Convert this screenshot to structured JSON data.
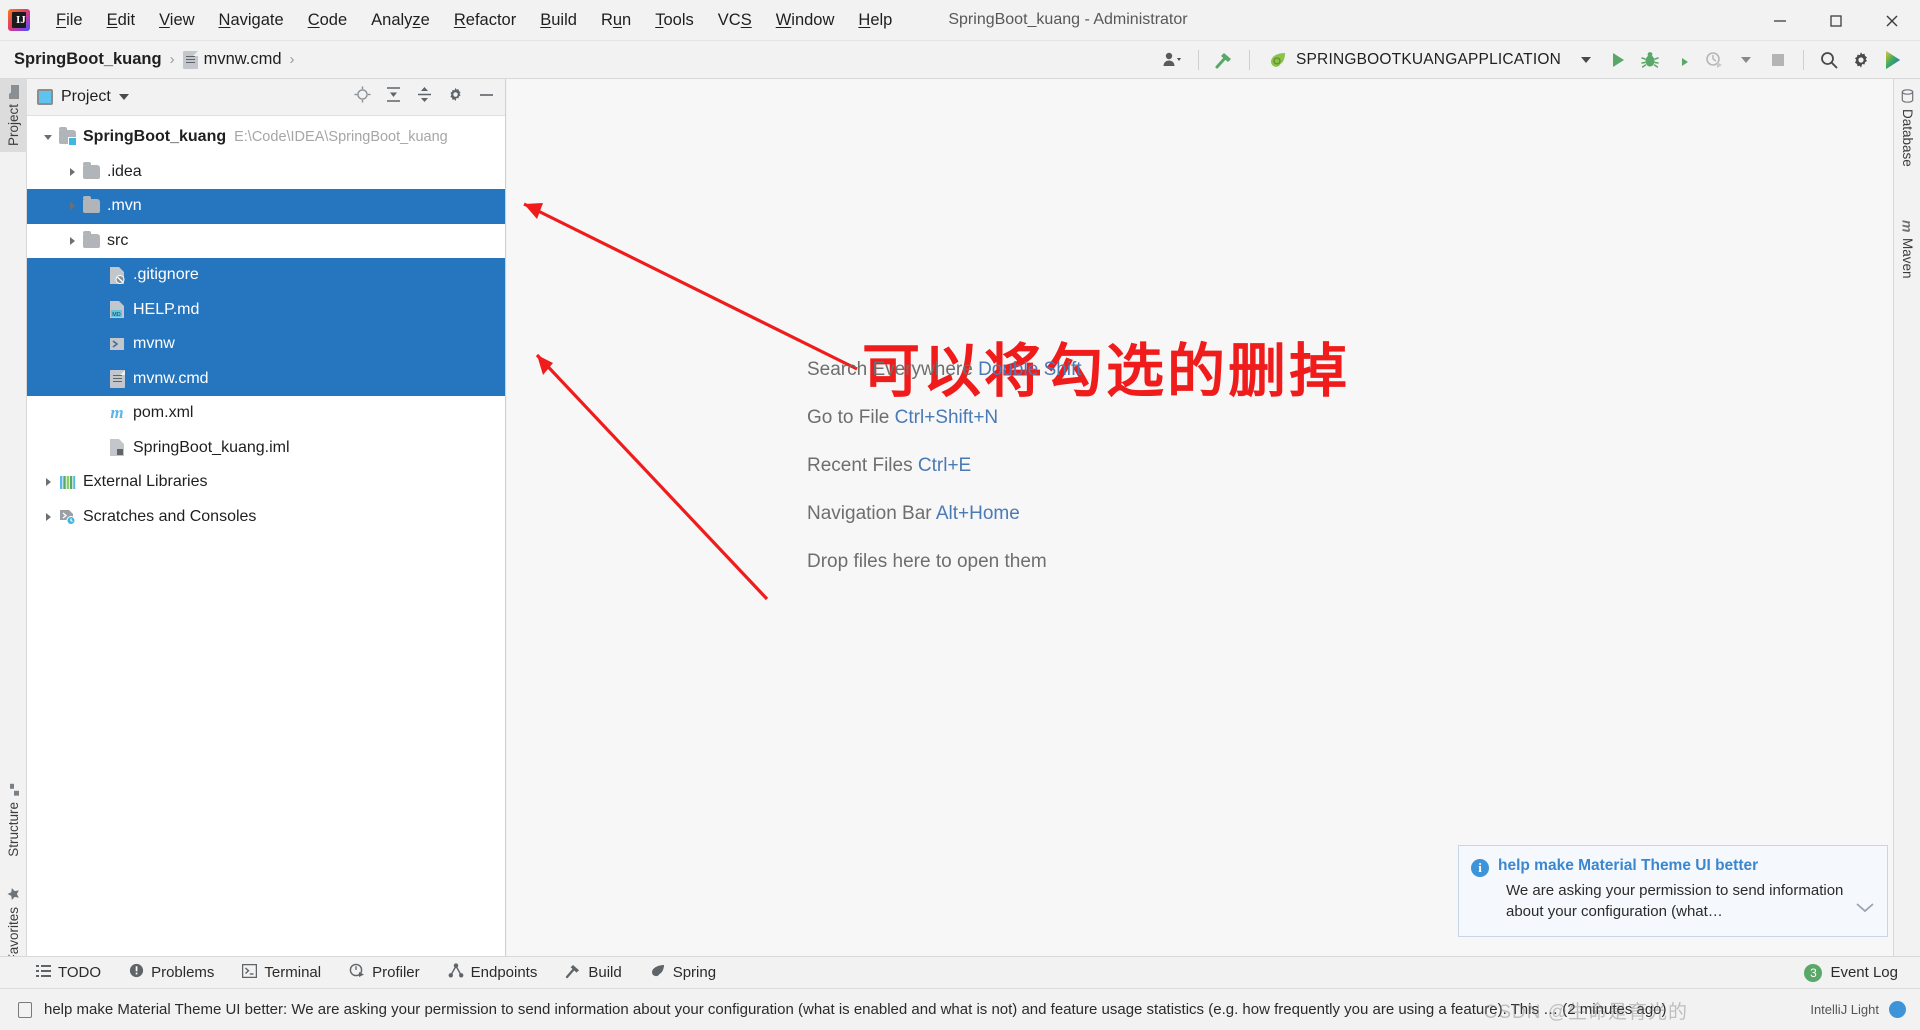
{
  "titlebar": {
    "menu": [
      {
        "label": "File",
        "mnemonic": "F"
      },
      {
        "label": "Edit",
        "mnemonic": "E"
      },
      {
        "label": "View",
        "mnemonic": "V"
      },
      {
        "label": "Navigate",
        "mnemonic": "N"
      },
      {
        "label": "Code",
        "mnemonic": "C"
      },
      {
        "label": "Analyze",
        "mnemonic": "z"
      },
      {
        "label": "Refactor",
        "mnemonic": "R"
      },
      {
        "label": "Build",
        "mnemonic": "B"
      },
      {
        "label": "Run",
        "mnemonic": "u"
      },
      {
        "label": "Tools",
        "mnemonic": "T"
      },
      {
        "label": "VCS",
        "mnemonic": "S"
      },
      {
        "label": "Window",
        "mnemonic": "W"
      },
      {
        "label": "Help",
        "mnemonic": "H"
      }
    ],
    "window_title": "SpringBoot_kuang - Administrator",
    "minimize_icon": "minimize-icon",
    "maximize_icon": "maximize-icon",
    "close_icon": "close-icon"
  },
  "navbar": {
    "breadcrumbs": [
      {
        "label": "SpringBoot_kuang",
        "bold": true
      },
      {
        "label": "mvnw.cmd",
        "bold": false
      }
    ],
    "separator": "›",
    "run_config": "SPRINGBOOTKUANGAPPLICATION",
    "icons": {
      "user_icon": "user-icon",
      "hammer_icon": "build-hammer-icon",
      "spring_leaf_icon": "spring-leaf-icon",
      "run_icon": "run-icon",
      "debug_icon": "debug-icon",
      "coverage_icon": "run-with-coverage-icon",
      "profile_icon": "profile-icon",
      "stop_icon": "stop-icon",
      "search_icon": "search-icon",
      "settings_icon": "settings-gear-icon",
      "ide_icon": "ide-logo-icon"
    }
  },
  "left_strip": {
    "tabs": [
      {
        "label": "Project",
        "active": true,
        "icon": "project-folder-icon"
      },
      {
        "label": "Structure",
        "active": false,
        "icon": "structure-icon"
      },
      {
        "label": "Favorites",
        "active": false,
        "icon": "star-icon"
      }
    ]
  },
  "right_strip": {
    "tabs": [
      {
        "label": "Database",
        "icon": "database-icon"
      },
      {
        "label": "Maven",
        "icon": "maven-m-icon"
      }
    ]
  },
  "project_panel": {
    "title": "Project",
    "header_icons": [
      "locate-icon",
      "expand-all-icon",
      "collapse-all-icon",
      "settings-gear-icon",
      "hide-icon"
    ],
    "tree": [
      {
        "label": "SpringBoot_kuang",
        "path": "E:\\Code\\IDEA\\SpringBoot_kuang",
        "indent": 0,
        "arrow": "down",
        "icon": "module-folder-icon",
        "selected": false,
        "bold": true
      },
      {
        "label": ".idea",
        "indent": 1,
        "arrow": "right",
        "icon": "folder-icon",
        "selected": false
      },
      {
        "label": ".mvn",
        "indent": 1,
        "arrow": "right",
        "icon": "folder-icon",
        "selected": true
      },
      {
        "label": "src",
        "indent": 1,
        "arrow": "right",
        "icon": "folder-icon",
        "selected": false
      },
      {
        "label": ".gitignore",
        "indent": 2,
        "arrow": "none",
        "icon": "gitignore-file-icon",
        "selected": true
      },
      {
        "label": "HELP.md",
        "indent": 2,
        "arrow": "none",
        "icon": "markdown-file-icon",
        "selected": true
      },
      {
        "label": "mvnw",
        "indent": 2,
        "arrow": "none",
        "icon": "shell-script-icon",
        "selected": true
      },
      {
        "label": "mvnw.cmd",
        "indent": 2,
        "arrow": "none",
        "icon": "cmd-file-icon",
        "selected": true
      },
      {
        "label": "pom.xml",
        "indent": 2,
        "arrow": "none",
        "icon": "maven-pom-icon",
        "selected": false
      },
      {
        "label": "SpringBoot_kuang.iml",
        "indent": 2,
        "arrow": "none",
        "icon": "iml-file-icon",
        "selected": false
      },
      {
        "label": "External Libraries",
        "indent": 0,
        "arrow": "right",
        "icon": "libraries-icon",
        "selected": false
      },
      {
        "label": "Scratches and Consoles",
        "indent": 0,
        "arrow": "right",
        "icon": "scratches-icon",
        "selected": false
      }
    ]
  },
  "editor": {
    "hints": [
      {
        "action": "Search Everywhere",
        "shortcut": "Double Shift"
      },
      {
        "action": "Go to File",
        "shortcut": "Ctrl+Shift+N"
      },
      {
        "action": "Recent Files",
        "shortcut": "Ctrl+E"
      },
      {
        "action": "Navigation Bar",
        "shortcut": "Alt+Home"
      },
      {
        "action": "Drop files here to open them",
        "shortcut": ""
      }
    ],
    "annotation": {
      "text": "可以将勾选的删掉",
      "color": "#f01c1c"
    }
  },
  "notification": {
    "title": "help make Material Theme UI better",
    "body": "We are asking your permission to send information about your configuration (what…",
    "info_icon": "info-icon",
    "chevron_icon": "chevron-down-icon"
  },
  "bottom_bar": {
    "items": [
      {
        "label": "TODO",
        "icon": "todo-list-icon"
      },
      {
        "label": "Problems",
        "icon": "problems-warning-icon"
      },
      {
        "label": "Terminal",
        "icon": "terminal-icon"
      },
      {
        "label": "Profiler",
        "icon": "profiler-icon"
      },
      {
        "label": "Endpoints",
        "icon": "endpoints-icon"
      },
      {
        "label": "Build",
        "icon": "build-hammer-icon"
      },
      {
        "label": "Spring",
        "icon": "spring-leaf-icon"
      }
    ],
    "event_log": {
      "label": "Event Log",
      "count": "3"
    }
  },
  "status_bar": {
    "message": "help make Material Theme UI better: We are asking your permission to send information about your configuration (what is enabled and what is not) and feature usage statistics (e.g. how frequently you are using a feature). This … (2 minutes ago)",
    "theme": "IntelliJ Light",
    "watermark": "CSDN @生命是育光的",
    "notify_icon": "notification-icon"
  },
  "colors": {
    "selection_blue": "#2675bf",
    "accent_blue": "#3d94d9",
    "hint_link": "#4a7ab5",
    "annotation_red": "#f01c1c",
    "green": "#59a869"
  }
}
